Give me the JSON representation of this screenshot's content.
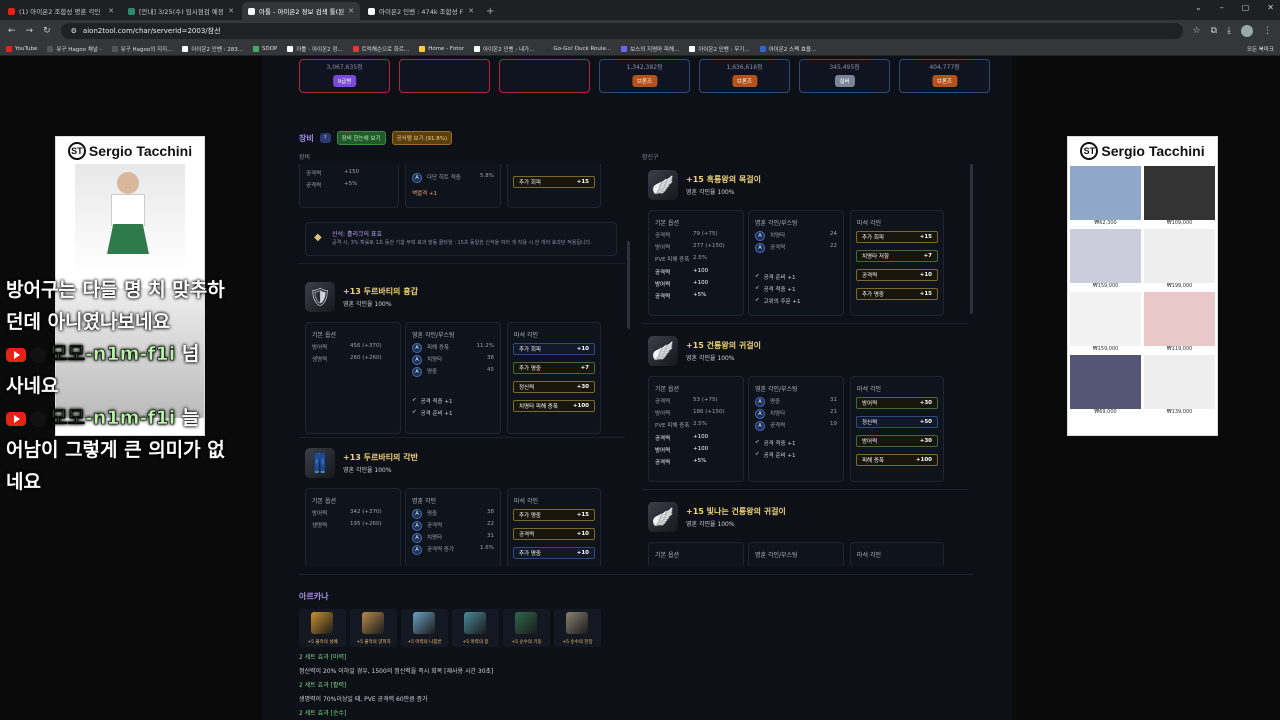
{
  "browser": {
    "tabs": [
      {
        "label": "(1) 아이온2 조합성 명훈 각인",
        "color": "#e62117",
        "active": false
      },
      {
        "label": "[안내] 3/25(수) 임시점검 예정",
        "color": "#2b8a6e",
        "active": false
      },
      {
        "label": "아툴 - 아이온2 정보 검색 툴(된",
        "color": "#ffffff",
        "active": true
      },
      {
        "label": "아이온2 인벤 : 474k 조합성 F",
        "color": "#ffffff",
        "active": false
      }
    ],
    "new_tab": "+",
    "url": "aion2tool.com/char/serverId=2003/참선",
    "bookmarks": [
      {
        "label": "YouTube",
        "color": "#e62117"
      },
      {
        "label": "유구 Hagoo 채널 -",
        "color": "#555"
      },
      {
        "label": "유구 Hagoo의 지지...",
        "color": "#555"
      },
      {
        "label": "아이온2 인벤 : 283...",
        "color": "#fff"
      },
      {
        "label": "SDOP",
        "color": "#4a6"
      },
      {
        "label": "아툴 - 아이온2 정...",
        "color": "#fff"
      },
      {
        "label": "트럭해슨으로 화르...",
        "color": "#e33"
      },
      {
        "label": "Home - Fotor",
        "color": "#fc3"
      },
      {
        "label": "아이온2 인벤 : 내가...",
        "color": "#fff"
      },
      {
        "label": "Go-Go! Duck Roule...",
        "color": "#333"
      },
      {
        "label": "보스의 지명마 피해...",
        "color": "#66f"
      },
      {
        "label": "아이온2 인벤 : 무기...",
        "color": "#fff"
      },
      {
        "label": "아이온2 스펙 효율...",
        "color": "#36c"
      }
    ],
    "bookmarks_right": "모든 북마크"
  },
  "chat": [
    {
      "text": "방어구는 다들 명 치 맞추하",
      "top": 0
    },
    {
      "text": "던데 아니였나보네요",
      "top": 0
    }
  ],
  "chat_msgs": {
    "line1": "방어구는 다들 명 치 맞추하",
    "line2": "던데 아니였나보네요",
    "nick1": "모모-n1m-f1i",
    "msg1a": " 넘",
    "msg1b": "사네요",
    "nick2": "모모-n1m-f1i",
    "msg2a": " 늘",
    "msg2b": "어남이 그렇게 큰 의미가 없",
    "msg2c": "네요"
  },
  "ads": {
    "left_logo": "Sergio Tacchini",
    "right_logo": "Sergio Tacchini",
    "right_prices": [
      "₩62,300",
      "₩62,300",
      "₩109,000",
      "₩159,000",
      "₩199,000",
      "₩159,000",
      "₩119,000",
      "₩69,000",
      "₩139,000"
    ]
  },
  "top_tiles": [
    {
      "num": "3,067,635점",
      "badge": "9급병",
      "badge_color": "#7a4ad8",
      "style": "red"
    },
    {
      "num": "",
      "badge": "",
      "badge_color": "",
      "style": "red"
    },
    {
      "num": "",
      "badge": "",
      "badge_color": "",
      "style": "red"
    },
    {
      "num": "1,342,382점",
      "badge": "브론즈",
      "badge_color": "#b5521c",
      "style": "blue"
    },
    {
      "num": "1,636,616점",
      "badge": "브론즈",
      "badge_color": "#b5521c",
      "style": "blue"
    },
    {
      "num": "345,495점",
      "badge": "실버",
      "badge_color": "#7a8599",
      "style": "blue"
    },
    {
      "num": "404,777점",
      "badge": "브론즈",
      "badge_color": "#b5521c",
      "style": "blue"
    }
  ],
  "equip": {
    "title": "장비",
    "chip_q": "?",
    "chip_1": "장비 한눈에 보기",
    "chip_2": "공식템 보기 (91.8%)",
    "left_label": "장비",
    "right_label": "장신구"
  },
  "left_cards": {
    "partial": {
      "rows": [
        {
          "k": "공격력",
          "v": "+150"
        },
        {
          "k": "공격력",
          "v": "+5%"
        }
      ],
      "mid_rows": [
        {
          "k": "다단 히트 적중",
          "v": "5.8%"
        }
      ],
      "mid_extra": "백열격 +1",
      "pill": {
        "k": "추가 회피",
        "v": "+15"
      },
      "set_title": "신석: 흘리크의 표효",
      "set_desc": "공격 시, 3% 확률로 1초 동안 기합 무력 효과 발동 쿨타임 : 15초 동일한 신석을 여러 개 착용 시 한 개의 효과만 적용됩니다."
    },
    "items": [
      {
        "name": "+13 두르바티의 흉갑",
        "pct": "영혼 각인율 100%",
        "icon": "🛡",
        "base_title": "기본 옵션",
        "base": [
          {
            "k": "방어력",
            "v": "456 (+370)"
          },
          {
            "k": "생명력",
            "v": "260 (+260)"
          }
        ],
        "soul_title": "영혼 각인/부스팅",
        "soul": [
          {
            "k": "피해 증폭",
            "v": "11.2%"
          },
          {
            "k": "치명타",
            "v": "38"
          },
          {
            "k": "명중",
            "v": "45"
          }
        ],
        "soul_extra": [
          "공격 적중 +1",
          "공격 준비 +1"
        ],
        "magic_title": "마석 각인",
        "magic": [
          {
            "k": "추가 회피",
            "v": "+10",
            "s": "b"
          },
          {
            "k": "추가 명중",
            "v": "+7",
            "s": "g"
          },
          {
            "k": "정신력",
            "v": "+30",
            "s": ""
          },
          {
            "k": "치명타 피해 증폭",
            "v": "+100",
            "s": ""
          }
        ]
      },
      {
        "name": "+13 두르바티의 각반",
        "pct": "영혼 각인율 100%",
        "icon": "👖",
        "base_title": "기본 옵션",
        "base": [
          {
            "k": "방어력",
            "v": "342 (+370)"
          },
          {
            "k": "생명력",
            "v": "195 (+260)"
          }
        ],
        "soul_title": "명훈 각인",
        "soul": [
          {
            "k": "명중",
            "v": "38"
          },
          {
            "k": "공격력",
            "v": "22"
          },
          {
            "k": "치명타",
            "v": "31"
          },
          {
            "k": "공격력 증가",
            "v": "1.6%"
          }
        ],
        "soul_extra": [],
        "magic_title": "마석 각인",
        "magic": [
          {
            "k": "추가 명중",
            "v": "+15",
            "s": ""
          },
          {
            "k": "공격력",
            "v": "+10",
            "s": ""
          },
          {
            "k": "추가 명중",
            "v": "+10",
            "s": "b"
          }
        ]
      }
    ]
  },
  "right_cards": [
    {
      "name": "+15 흑룡왕의 목걸이",
      "pct": "영혼 각인율 100%",
      "icon": "🪽",
      "base_title": "기본 옵션",
      "base": [
        {
          "k": "공격력",
          "v": "79 (+75)"
        },
        {
          "k": "방어력",
          "v": "277 (+150)"
        },
        {
          "k": "PVE 피해 증폭",
          "v": "2.5%"
        }
      ],
      "base_bold": [
        {
          "k": "공격력",
          "v": "+100"
        },
        {
          "k": "방어력",
          "v": "+100"
        },
        {
          "k": "공격력",
          "v": "+5%"
        }
      ],
      "soul_title": "명훈 각인/부스팅",
      "soul": [
        {
          "k": "치명타",
          "v": "24"
        },
        {
          "k": "공격력",
          "v": "22"
        }
      ],
      "soul_extra": [
        "공격 준비 +1",
        "공격 적중 +1",
        "고위의 주문 +1"
      ],
      "magic_title": "마석 각인",
      "magic": [
        {
          "k": "추가 회피",
          "v": "+15",
          "s": ""
        },
        {
          "k": "치명타 저항",
          "v": "+7",
          "s": "g"
        },
        {
          "k": "공격력",
          "v": "+10",
          "s": ""
        },
        {
          "k": "추가 명중",
          "v": "+15",
          "s": ""
        }
      ]
    },
    {
      "name": "+15 건룡왕의 귀걸이",
      "pct": "영혼 각인율 100%",
      "icon": "🪽",
      "base_title": "기본 옵션",
      "base": [
        {
          "k": "공격력",
          "v": "53 (+75)"
        },
        {
          "k": "방어력",
          "v": "186 (+150)"
        },
        {
          "k": "PVE 피해 증폭",
          "v": "2.5%"
        }
      ],
      "base_bold": [
        {
          "k": "공격력",
          "v": "+100"
        },
        {
          "k": "방어력",
          "v": "+100"
        },
        {
          "k": "공격력",
          "v": "+5%"
        }
      ],
      "soul_title": "영혼 각인/부스팅",
      "soul": [
        {
          "k": "명중",
          "v": "31"
        },
        {
          "k": "치명타",
          "v": "21"
        },
        {
          "k": "공격력",
          "v": "19"
        }
      ],
      "soul_extra": [
        "공격 적중 +1",
        "공격 준비 +1"
      ],
      "magic_title": "마석 각인",
      "magic": [
        {
          "k": "방어력",
          "v": "+30",
          "s": "g"
        },
        {
          "k": "정신력",
          "v": "+50",
          "s": "b"
        },
        {
          "k": "방어력",
          "v": "+30",
          "s": "g"
        },
        {
          "k": "피해 증폭",
          "v": "+100",
          "s": ""
        }
      ]
    },
    {
      "name": "+15 빛나는 건룡왕의 귀걸이",
      "pct": "영혼 각인율 100%",
      "icon": "🪽",
      "base_title": "기본 옵션",
      "base": [],
      "base_bold": [],
      "soul_title": "명훈 각인/부스팅",
      "soul": [],
      "soul_extra": [],
      "magic_title": "마석 각인",
      "magic": []
    }
  ],
  "arcana": {
    "title": "아르카나",
    "cards": [
      {
        "label": "+5 불막의 성배",
        "color": "#c8912e"
      },
      {
        "label": "+5 불막의 양피지",
        "color": "#b58a4a"
      },
      {
        "label": "+5 마력의 나침반",
        "color": "#6aa0c0"
      },
      {
        "label": "+5 마력의 종",
        "color": "#4a8a9a"
      },
      {
        "label": "+5 순수의 기둥",
        "color": "#2d6a4a"
      },
      {
        "label": "+5 순수의 찬장",
        "color": "#8a8070"
      }
    ],
    "sets": [
      {
        "title": "2 세트 효과 [마력]",
        "desc": "정신력이 20% 이하일 경우, 1500의 정신력을 즉시 회복 [재사용 시간 30초]"
      },
      {
        "title": "2 세트 효과 [활력]",
        "desc": "생명력이 70%이상일 때, PVE 공격력 60만큼 증가"
      },
      {
        "title": "2 세트 효과 [순수]",
        "desc": ""
      }
    ]
  }
}
